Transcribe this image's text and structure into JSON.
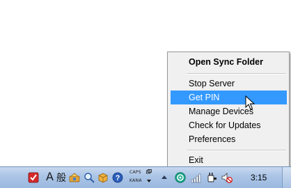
{
  "context_menu": {
    "items": [
      {
        "label": "Open Sync Folder",
        "bold": true
      },
      {
        "label": "Stop Server"
      },
      {
        "label": "Get PIN",
        "highlighted": true
      },
      {
        "label": "Manage Devices"
      },
      {
        "label": "Check for Updates"
      },
      {
        "label": "Preferences"
      },
      {
        "label": "Exit"
      }
    ],
    "highlight_color": "#3399ff"
  },
  "taskbar": {
    "ime": {
      "mode_letter": "A",
      "dictionary_char": "般",
      "caps_label": "CAPS",
      "kana_label": "KANA"
    },
    "tray_icons": [
      "antivirus-shield-icon",
      "ime-mode-icon",
      "ime-dictionary-icon",
      "ime-tools-icon",
      "ime-search-icon",
      "ime-package-icon",
      "help-icon",
      "ime-caps-icon",
      "ime-kana-icon",
      "sync-app-icon",
      "network-signal-icon",
      "power-plug-icon",
      "volume-muted-icon"
    ],
    "clock": "3:15"
  }
}
